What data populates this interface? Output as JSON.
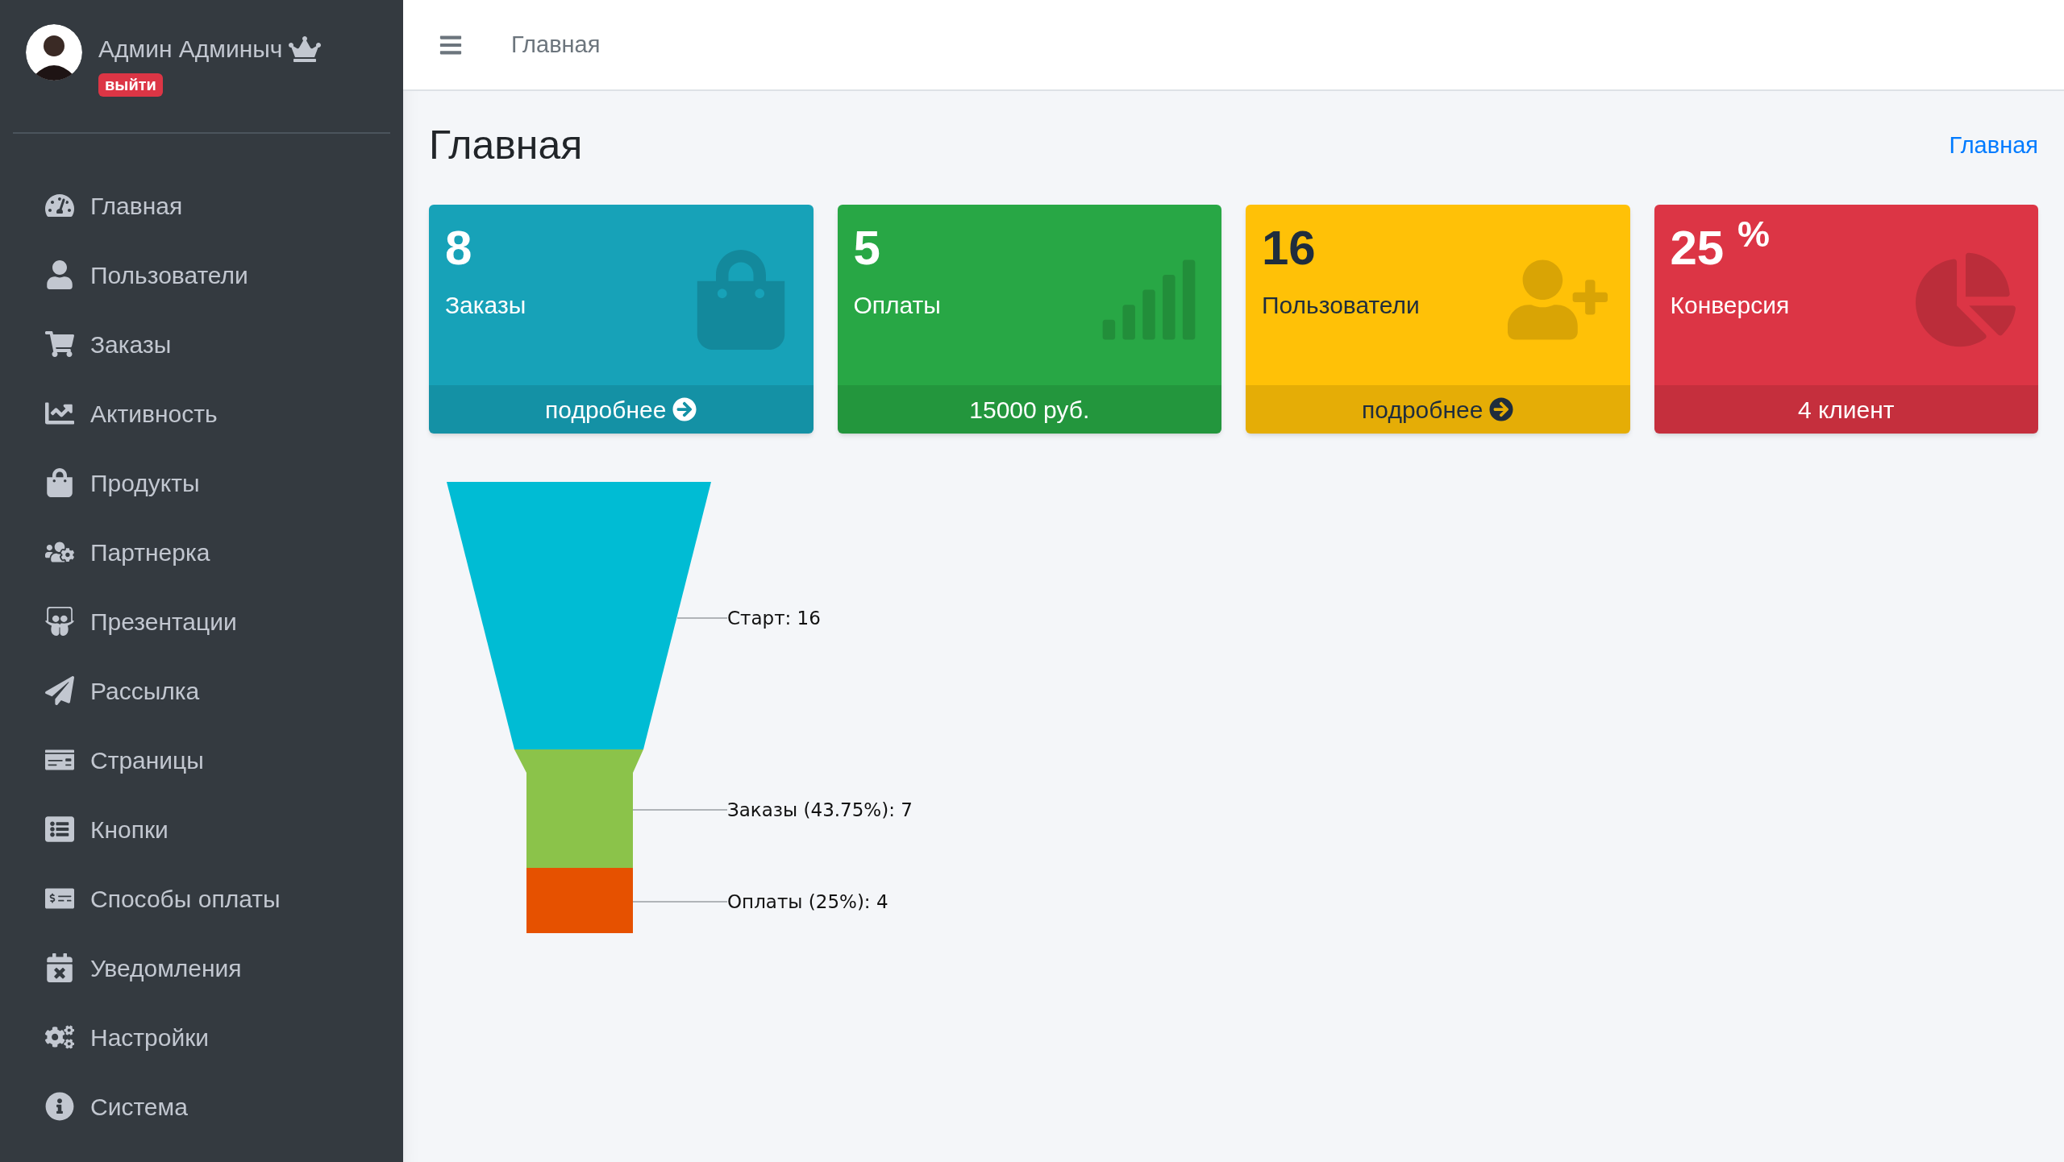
{
  "sidebar": {
    "user": {
      "name": "Админ Админыч",
      "logout": "выйти"
    },
    "items": [
      {
        "label": "Главная"
      },
      {
        "label": "Пользователи"
      },
      {
        "label": "Заказы"
      },
      {
        "label": "Активность"
      },
      {
        "label": "Продукты"
      },
      {
        "label": "Партнерка"
      },
      {
        "label": "Презентации"
      },
      {
        "label": "Рассылка"
      },
      {
        "label": "Страницы"
      },
      {
        "label": "Кнопки"
      },
      {
        "label": "Способы оплаты"
      },
      {
        "label": "Уведомления"
      },
      {
        "label": "Настройки"
      },
      {
        "label": "Система"
      }
    ]
  },
  "header": {
    "title": "Главная"
  },
  "page": {
    "title": "Главная",
    "breadcrumb": "Главная"
  },
  "cards": [
    {
      "value": "8",
      "label": "Заказы",
      "footer": "подробнее",
      "arrow": true,
      "color": "#17a2b8"
    },
    {
      "value": "5",
      "label": "Оплаты",
      "footer": "15000 руб.",
      "arrow": false,
      "color": "#28a745"
    },
    {
      "value": "16",
      "label": "Пользователи",
      "footer": "подробнее",
      "arrow": true,
      "color": "#ffc107"
    },
    {
      "value": "25 $^{%}$",
      "label": "Конверсия",
      "footer": "4 клиент",
      "arrow": false,
      "color": "#dc3545"
    }
  ],
  "funnel": {
    "stages": [
      {
        "label": "Старт: 16",
        "color": "#00bcd4"
      },
      {
        "label": "Заказы (43.75%): 7",
        "color": "#8bc34a"
      },
      {
        "label": "Оплаты (25%): 4",
        "color": "#e65100"
      }
    ]
  }
}
